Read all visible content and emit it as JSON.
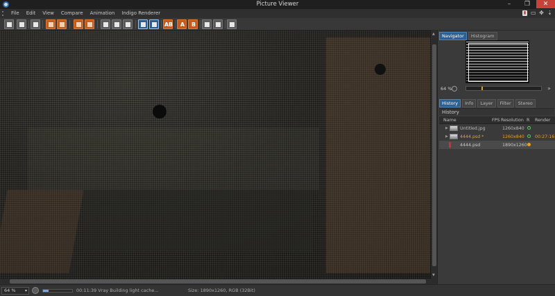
{
  "window": {
    "title": "Picture Viewer",
    "min_glyph": "–",
    "max_glyph": "❐",
    "close_glyph": "✕"
  },
  "menu": {
    "items": [
      "File",
      "Edit",
      "View",
      "Compare",
      "Animation",
      "Indigo Renderer"
    ]
  },
  "toolbar": {
    "buttons": [
      "open",
      "save",
      "save-sequence",
      "render-region",
      "render-clear",
      "stop",
      "channel-a",
      "channel-b",
      "fit-view",
      "full-view",
      "compare-a",
      "compare-b",
      "text-a",
      "text-b",
      "flip-a",
      "flip-b",
      "split-a",
      "split-b"
    ],
    "text_a": "A",
    "text_b": "B"
  },
  "navigator": {
    "tabs": [
      "Navigator",
      "Histogram"
    ],
    "zoom": "64 %"
  },
  "history": {
    "tabs": [
      "History",
      "Info",
      "Layer",
      "Filter",
      "Stereo"
    ],
    "title": "History",
    "columns": [
      "Name",
      "FPS",
      "Resolution",
      "R",
      "Render"
    ],
    "rows": [
      {
        "name": "Untitled.jpg",
        "fps": "",
        "resolution": "1260x840",
        "render": ""
      },
      {
        "name": "4444.psd *",
        "fps": "",
        "resolution": "1260x840",
        "render": "00:27:16"
      },
      {
        "name": "4444.psd",
        "fps": "",
        "resolution": "1890x1260",
        "render": ""
      }
    ]
  },
  "status": {
    "zoom": "64 %",
    "progress": 0.2,
    "message": "00:11:39 Vray Building light cache...",
    "size": "Size: 1890x1260, RGB (32Bit)"
  },
  "colors": {
    "accent": "#2e5f93",
    "close": "#c7433a",
    "modified": "#e6a02c"
  }
}
